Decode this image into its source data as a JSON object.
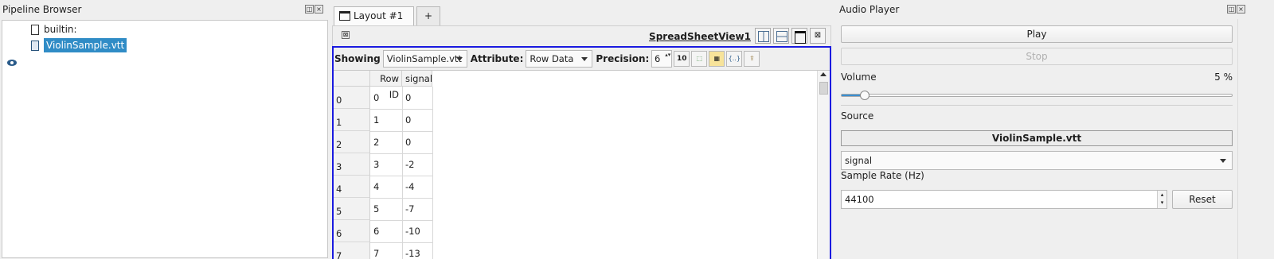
{
  "pipeline": {
    "title": "Pipeline Browser",
    "items": [
      {
        "label": "builtin:"
      },
      {
        "label": "ViolinSample.vtt"
      }
    ]
  },
  "layout": {
    "tab_label": "Layout #1",
    "tab_close": "⊠",
    "add_tab": "+",
    "view_name": "SpreadSheetView1",
    "view_close": "⊠",
    "toolbar": {
      "showing_label": "Showing",
      "showing_value": "ViolinSample.vtt",
      "attribute_label": "Attribute:",
      "attribute_value": "Row Data",
      "precision_label": "Precision:",
      "precision_value": "6",
      "fixed_rep_label": "10"
    },
    "table": {
      "columns": [
        "Row ID",
        "signal"
      ],
      "rows": [
        {
          "idx": "0",
          "row_id": "0",
          "signal": "0"
        },
        {
          "idx": "1",
          "row_id": "1",
          "signal": "0"
        },
        {
          "idx": "2",
          "row_id": "2",
          "signal": "0"
        },
        {
          "idx": "3",
          "row_id": "3",
          "signal": "-2"
        },
        {
          "idx": "4",
          "row_id": "4",
          "signal": "-4"
        },
        {
          "idx": "5",
          "row_id": "5",
          "signal": "-7"
        },
        {
          "idx": "6",
          "row_id": "6",
          "signal": "-10"
        },
        {
          "idx": "7",
          "row_id": "7",
          "signal": "-13"
        }
      ]
    }
  },
  "audio": {
    "title": "Audio Player",
    "play": "Play",
    "stop": "Stop",
    "volume_label": "Volume",
    "volume_value": "5 %",
    "volume_fraction": 0.05,
    "source_label": "Source",
    "source_value": "ViolinSample.vtt",
    "array_value": "signal",
    "sample_rate_label": "Sample Rate (Hz)",
    "sample_rate_value": "44100",
    "reset": "Reset"
  },
  "colors": {
    "accent": "#308cc6",
    "frame_border": "#1a1ae0"
  }
}
